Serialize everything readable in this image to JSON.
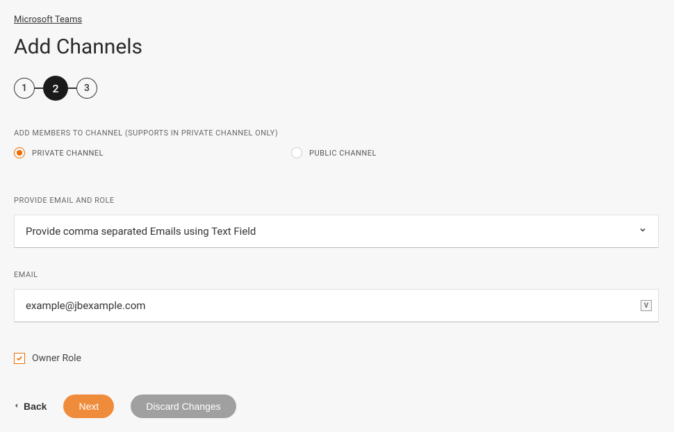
{
  "breadcrumb": "Microsoft Teams",
  "title": "Add Channels",
  "stepper": {
    "steps": [
      "1",
      "2",
      "3"
    ],
    "active": 1
  },
  "membersSection": {
    "label": "ADD MEMBERS TO CHANNEL (SUPPORTS IN PRIVATE CHANNEL ONLY)",
    "privateLabel": "PRIVATE CHANNEL",
    "publicLabel": "PUBLIC CHANNEL",
    "selected": "private"
  },
  "emailRoleSection": {
    "label": "PROVIDE EMAIL AND ROLE",
    "selectedOption": "Provide comma separated Emails using Text Field"
  },
  "emailSection": {
    "label": "EMAIL",
    "value": "example@jbexample.com",
    "badge": "V"
  },
  "ownerRole": {
    "label": "Owner Role",
    "checked": true
  },
  "buttons": {
    "back": "Back",
    "next": "Next",
    "discard": "Discard Changes"
  }
}
